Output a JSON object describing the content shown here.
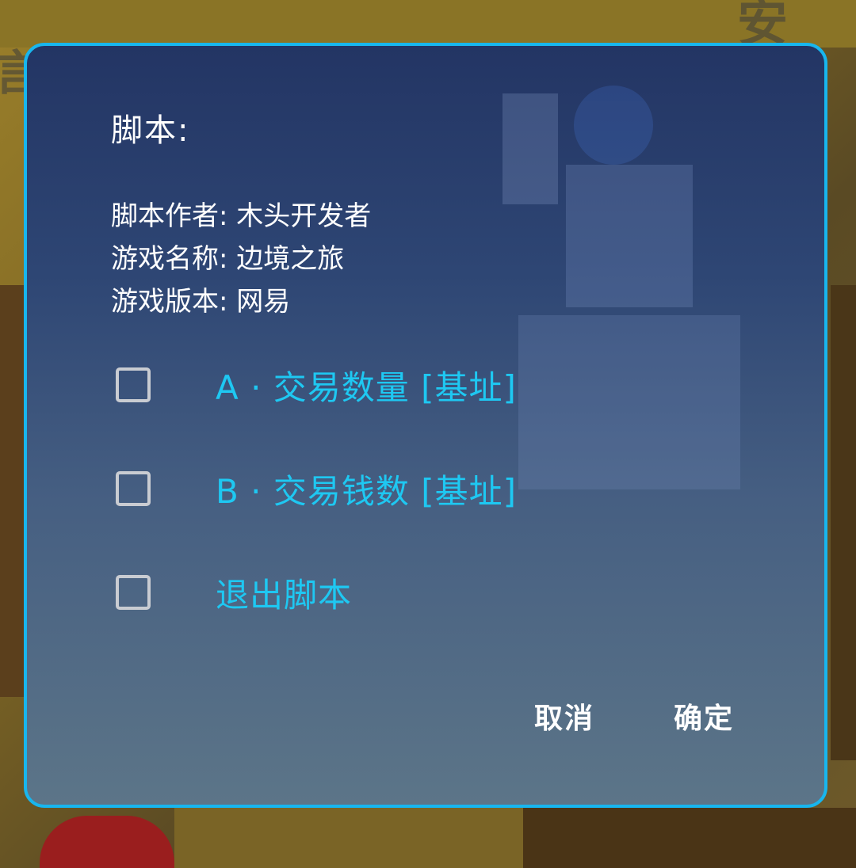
{
  "dialog": {
    "title": "脚本:",
    "info": {
      "author": "脚本作者: 木头开发者",
      "game_name": "游戏名称: 边境之旅",
      "game_version": "游戏版本: 网易"
    },
    "options": [
      {
        "label": "A · 交易数量 [基址]",
        "checked": false
      },
      {
        "label": "B · 交易钱数 [基址]",
        "checked": false
      },
      {
        "label": "退出脚本",
        "checked": false
      }
    ],
    "buttons": {
      "cancel": "取消",
      "confirm": "确定"
    }
  },
  "colors": {
    "accent": "#1ec8f2",
    "border": "#18b6ee",
    "text": "#ffffff"
  }
}
